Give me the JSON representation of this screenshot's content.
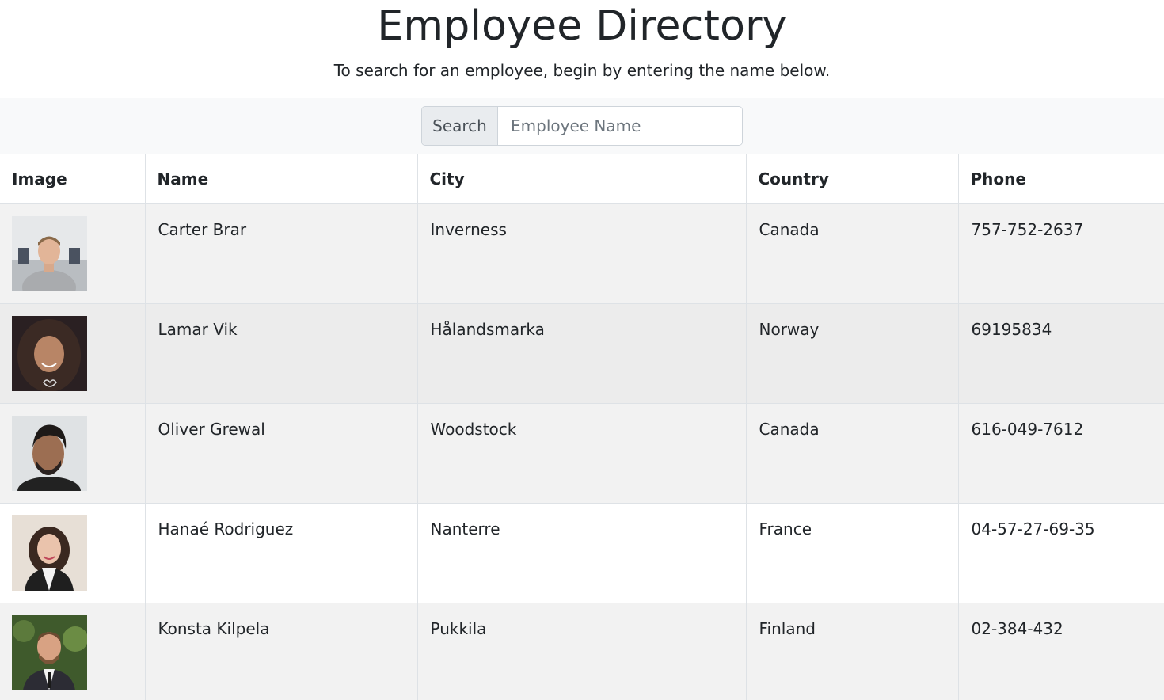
{
  "header": {
    "title": "Employee Directory",
    "subtitle": "To search for an employee, begin by entering the name below."
  },
  "search": {
    "prefix_label": "Search",
    "placeholder": "Employee Name",
    "value": ""
  },
  "table": {
    "columns": [
      "Image",
      "Name",
      "City",
      "Country",
      "Phone"
    ],
    "rows": [
      {
        "name": "Carter Brar",
        "city": "Inverness",
        "country": "Canada",
        "phone": "757-752-2637"
      },
      {
        "name": "Lamar Vik",
        "city": "Hålandsmarka",
        "country": "Norway",
        "phone": "69195834"
      },
      {
        "name": "Oliver Grewal",
        "city": "Woodstock",
        "country": "Canada",
        "phone": "616-049-7612"
      },
      {
        "name": "Hanaé Rodriguez",
        "city": "Nanterre",
        "country": "France",
        "phone": "04-57-27-69-35"
      },
      {
        "name": "Konsta Kilpela",
        "city": "Pukkila",
        "country": "Finland",
        "phone": "02-384-432"
      }
    ]
  }
}
